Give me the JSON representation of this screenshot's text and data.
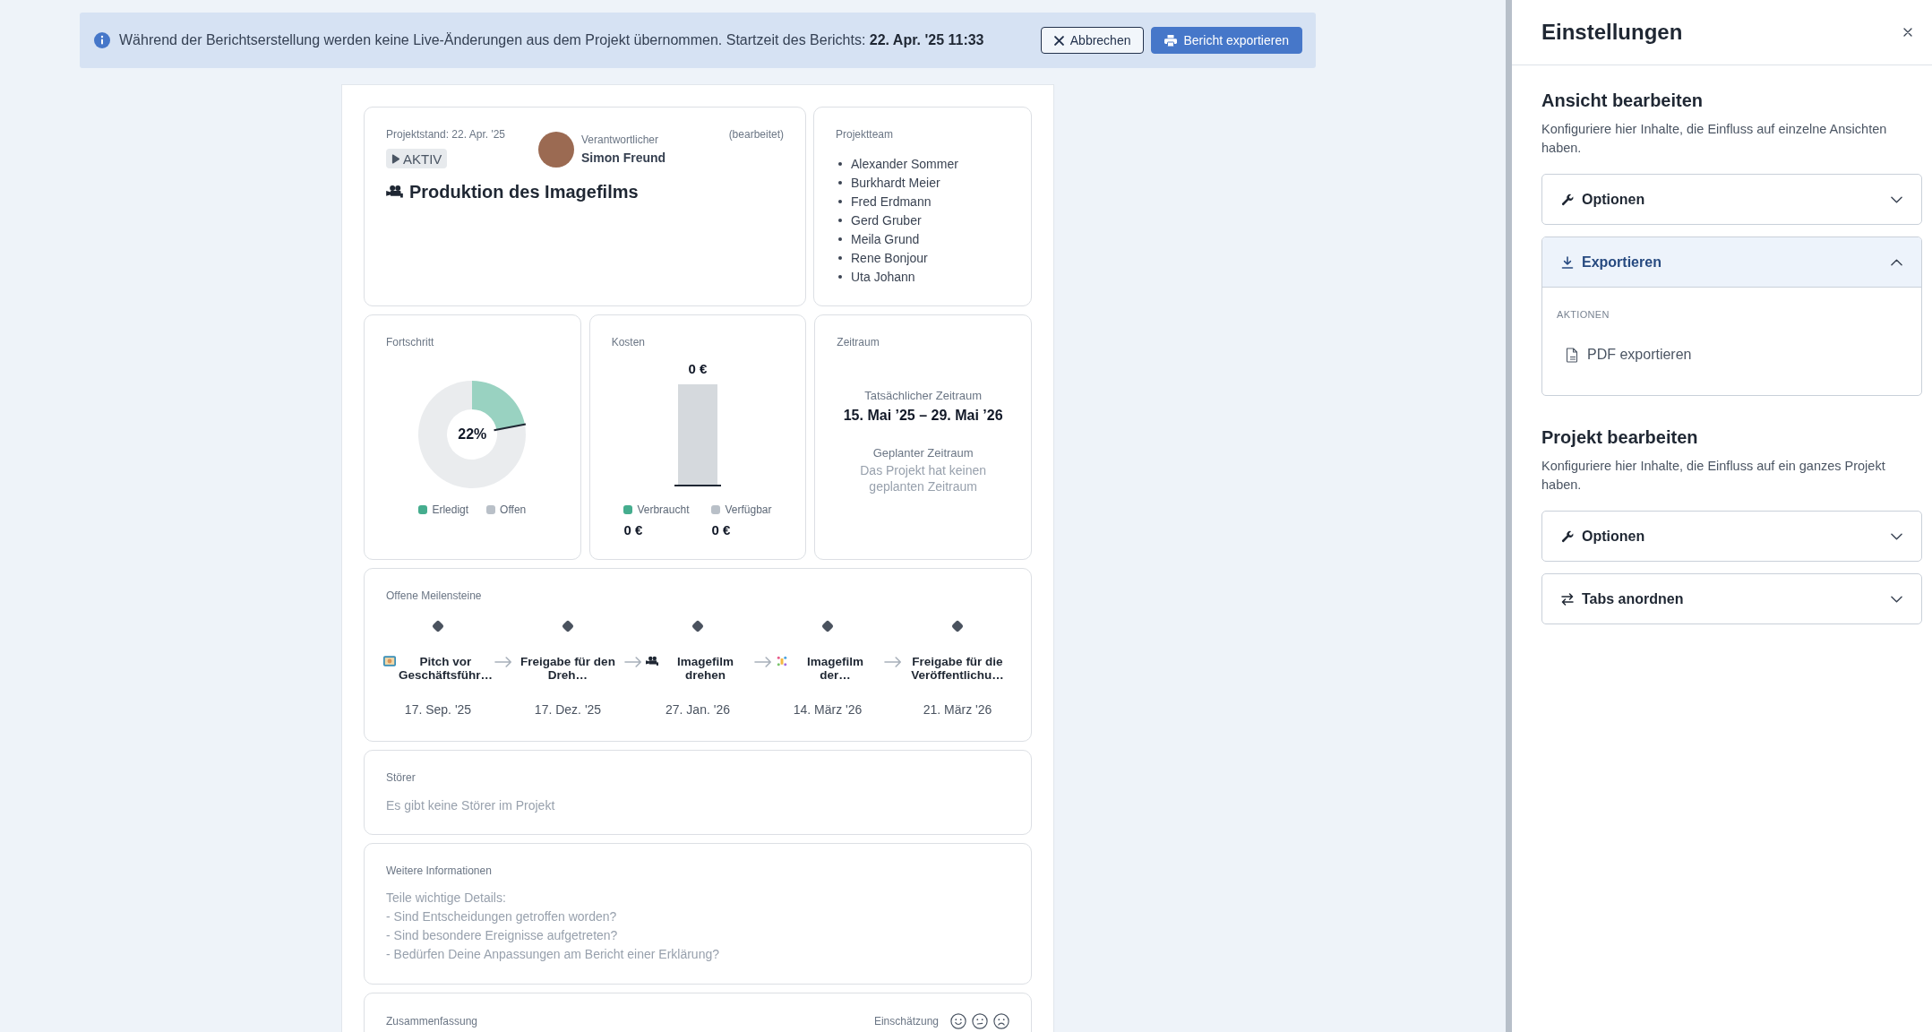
{
  "banner": {
    "message": "Während der Berichtserstellung werden keine Live-Änderungen aus dem Projekt übernommen. Startzeit des Berichts: **22. Apr. '25 11:33**",
    "buttons": [
      {
        "kind": "cancel",
        "label": "Abbrechen"
      },
      {
        "kind": "export",
        "label": "Bericht exportieren"
      }
    ]
  },
  "project": {
    "status_date": "Projektstand: 22. Apr. '25",
    "status": "AKTIV",
    "responsible_label": "Verantwortlicher",
    "responsible_name": "Simon Freund",
    "edited": "(bearbeitet)",
    "title": "Produktion des Imagefilms"
  },
  "team": {
    "title": "Projektteam",
    "members": [
      "Alexander Sommer",
      "Burkhardt Meier",
      "Fred Erdmann",
      "Gerd Gruber",
      "Meila Grund",
      "Rene Bonjour",
      "Uta Johann"
    ]
  },
  "progress": {
    "title": "Fortschritt",
    "center_label": "22%",
    "legend": [
      {
        "color": "#45ad8e"
      },
      {
        "color": "#b9c0c8"
      }
    ],
    "chart_data": {
      "type": "donut",
      "categories": [
        "Erledigt",
        "Offen"
      ],
      "values": [
        22,
        78
      ]
    }
  },
  "costs": {
    "title": "Kosten",
    "total": "0 €",
    "legend": [
      {
        "label": "Verbraucht",
        "color": "#45ad8e",
        "value": "0 €"
      },
      {
        "label": "Verfügbar",
        "color": "#b9c0c8",
        "value": "0 €"
      }
    ]
  },
  "period": {
    "title": "Zeitraum",
    "actual_label": "Tatsächlicher Zeitraum",
    "actual_range": "15. Mai ’25 – 29. Mai ’26",
    "planned_label": "Geplanter Zeitraum",
    "planned_text": "Das Projekt hat keinen geplanten Zeitraum"
  },
  "milestones": {
    "title": "Offene Meilensteine",
    "items": [
      {
        "kind": "picture",
        "title": "Pitch vor Geschäftsführ…",
        "date": "17. Sep. '25"
      },
      {
        "kind": "plain",
        "title": "Freigabe für den Dreh…",
        "date": "17. Dez. '25"
      },
      {
        "kind": "camera",
        "title": "Imagefilm drehen",
        "date": "27. Jan. '26"
      },
      {
        "kind": "confetti",
        "title": "Imagefilm der…",
        "date": "14. März '26"
      },
      {
        "kind": "plain",
        "title": "Freigabe für die Veröffentlichu…",
        "date": "21. März '26"
      }
    ]
  },
  "issues": {
    "title": "Störer",
    "text": "Es gibt keine Störer im Projekt"
  },
  "info": {
    "title": "Weitere Informationen",
    "text": "Teile wichtige Details:\n- Sind Entscheidungen getroffen worden?\n- Sind besondere Ereignisse aufgetreten?\n- Bedürfen Deine Anpassungen am Bericht einer Erklärung?"
  },
  "summary": {
    "title": "Zusammenfassung",
    "rating_label": "Einschätzung",
    "ratings": [
      {
        "kind": "happy",
        "selected": false
      },
      {
        "kind": "neutral",
        "selected": false
      },
      {
        "kind": "sad",
        "selected": false
      }
    ]
  },
  "settings": {
    "title": "Einstellungen",
    "sections": [
      {
        "heading": "Ansicht bearbeiten",
        "description": "Konfiguriere hier Inhalte, die Einfluss auf einzelne Ansichten haben.",
        "panels": [
          {
            "kind": "options",
            "label": "Optionen",
            "expanded": false
          },
          {
            "kind": "export",
            "label": "Exportieren",
            "expanded": true,
            "group": "AKTIONEN",
            "actions": [
              {
                "label": "PDF exportieren"
              }
            ]
          }
        ]
      },
      {
        "heading": "Projekt bearbeiten",
        "description": "Konfiguriere hier Inhalte, die Einfluss auf ein ganzes Projekt haben.",
        "panels": [
          {
            "kind": "options",
            "label": "Optionen",
            "expanded": false
          },
          {
            "kind": "arrange",
            "label": "Tabs anordnen",
            "expanded": false
          }
        ]
      }
    ]
  }
}
